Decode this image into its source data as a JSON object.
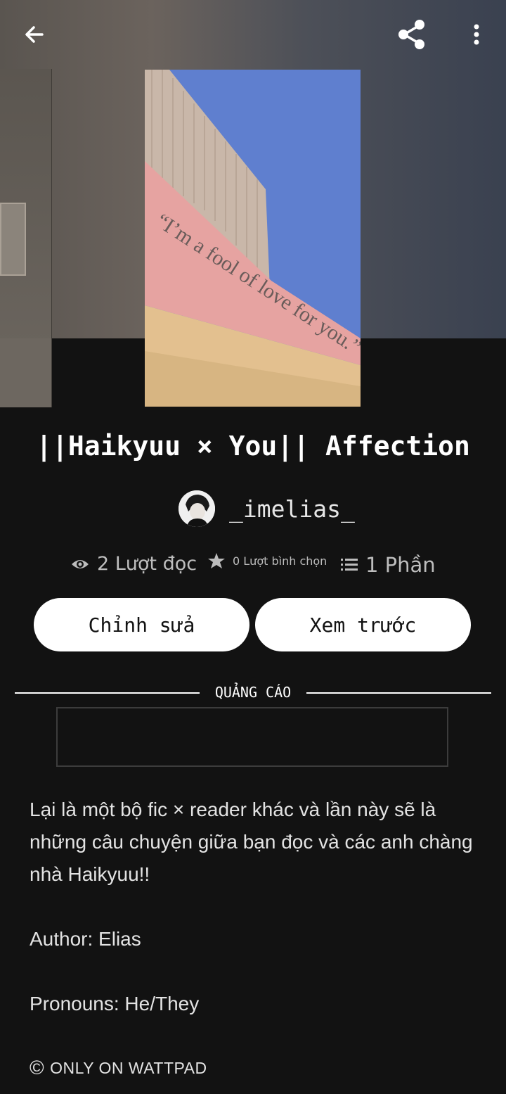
{
  "story": {
    "title": "||Haikyuu × You||  Affection",
    "cover_quote": "“I’m a fool of love for you.”",
    "author": "_imelias_"
  },
  "stats": {
    "reads": "2 Lượt đọc",
    "votes": "0 Lượt bình chọn",
    "parts": "1 Phần"
  },
  "actions": {
    "edit_label": "Chỉnh sửa",
    "preview_label": "Xem trước"
  },
  "ad": {
    "label": "QUẢNG CÁO"
  },
  "description": {
    "paragraph1": "Lại là một bộ fic × reader khác và lần này sẽ là những câu chuyện giữa bạn đọc và các anh chàng nhà Haikyuu!!",
    "paragraph2": "Author: Elias",
    "paragraph3": "Pronouns: He/They"
  },
  "copyright": {
    "symbol": "©",
    "text": "ONLY ON WATTPAD"
  },
  "icons": {
    "back": "back-arrow-icon",
    "share": "share-icon",
    "more": "more-vertical-icon",
    "eye": "eye-icon",
    "star": "star-icon",
    "list": "list-icon"
  }
}
